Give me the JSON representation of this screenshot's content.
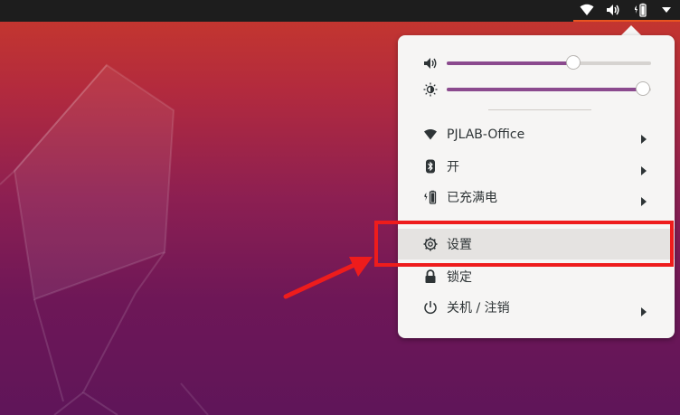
{
  "topbar": {
    "tray_icons": [
      "wifi-icon",
      "volume-icon",
      "battery-icon",
      "dropdown-arrow-icon"
    ]
  },
  "menu": {
    "volume": {
      "icon": "volume-icon",
      "level": 0.62
    },
    "brightness": {
      "icon": "brightness-icon",
      "level": 0.96
    },
    "items": [
      {
        "icon": "wifi-icon",
        "label": "PJLAB-Office",
        "has_submenu": true
      },
      {
        "icon": "bluetooth-icon",
        "label": "开",
        "has_submenu": true
      },
      {
        "icon": "battery-icon",
        "label": "已充满电",
        "has_submenu": true
      },
      {
        "icon": "settings-gear-icon",
        "label": "设置",
        "has_submenu": false,
        "highlighted": true
      },
      {
        "icon": "lock-icon",
        "label": "锁定",
        "has_submenu": false
      },
      {
        "icon": "power-icon",
        "label": "关机 / 注销",
        "has_submenu": true
      }
    ]
  },
  "colors": {
    "accent": "#e95420",
    "slider_fill": "#8b4a8e",
    "annotation_red": "#ee1c1c",
    "menu_bg": "#f6f5f4"
  }
}
